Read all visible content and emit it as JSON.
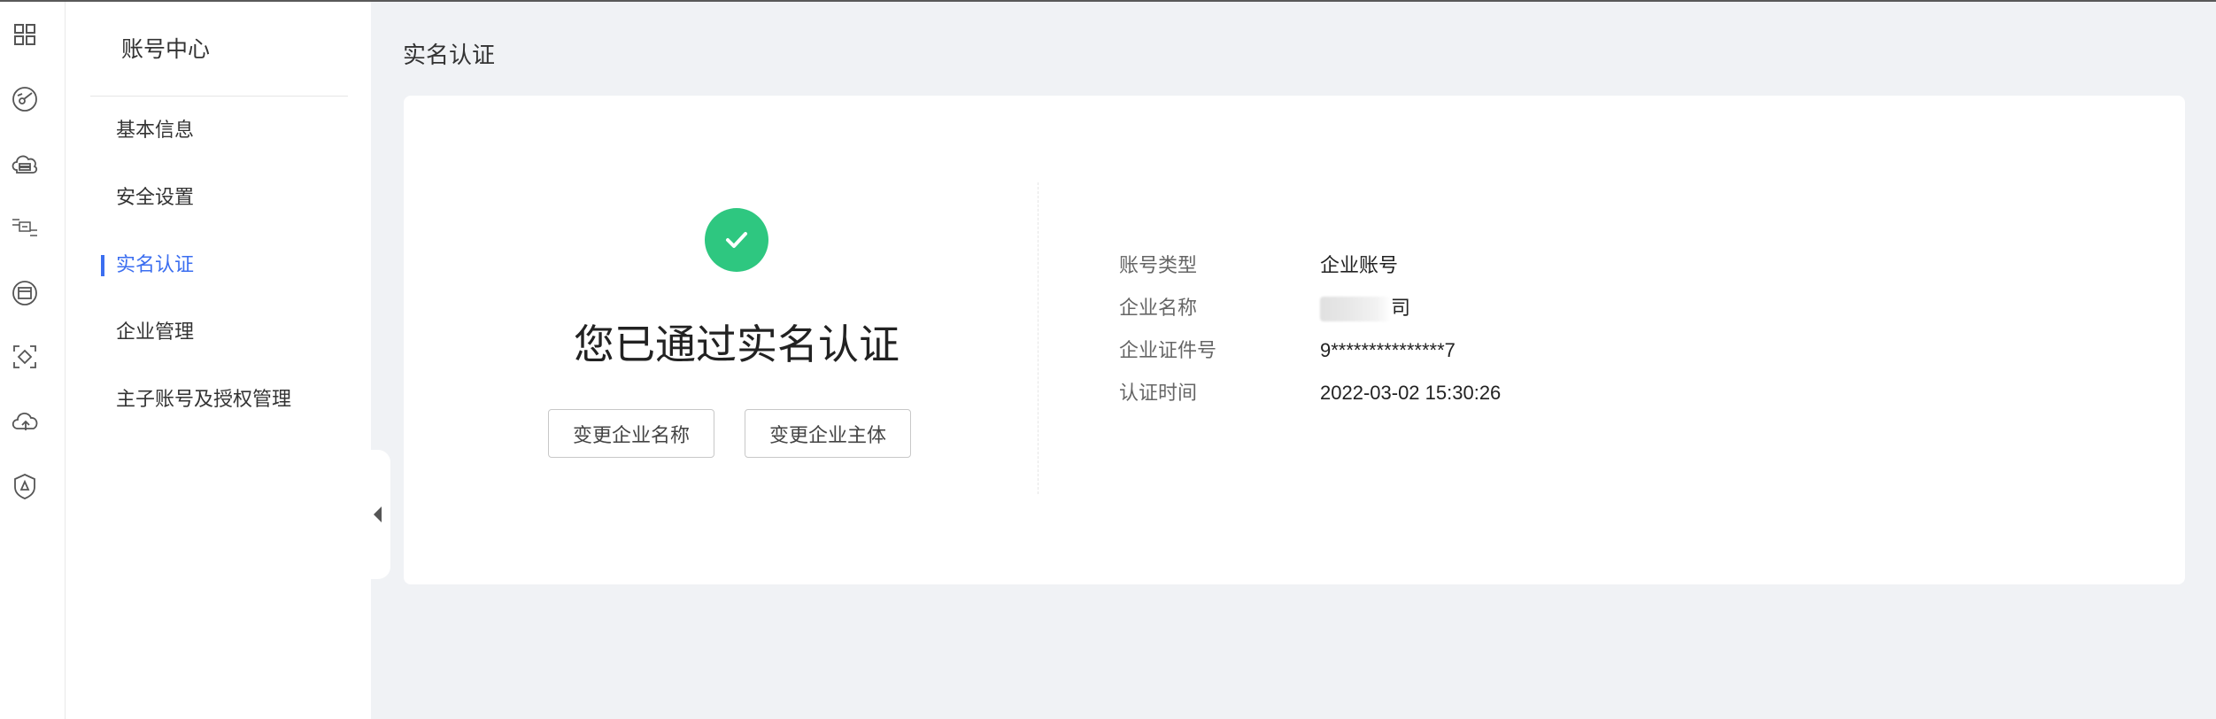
{
  "rail": {
    "icons": [
      "grid-icon",
      "gauge-icon",
      "cloud-server-icon",
      "network-icon",
      "window-icon",
      "scan-icon",
      "cloud-upload-icon",
      "shield-icon"
    ]
  },
  "sidebar": {
    "title": "账号中心",
    "items": [
      {
        "label": "基本信息",
        "active": false
      },
      {
        "label": "安全设置",
        "active": false
      },
      {
        "label": "实名认证",
        "active": true
      },
      {
        "label": "企业管理",
        "active": false
      },
      {
        "label": "主子账号及授权管理",
        "active": false
      }
    ]
  },
  "page": {
    "title": "实名认证"
  },
  "verification": {
    "status_text": "您已通过实名认证",
    "status_color": "#2ec780",
    "buttons": {
      "change_name": "变更企业名称",
      "change_entity": "变更企业主体"
    }
  },
  "details": [
    {
      "label": "账号类型",
      "value": "企业账号"
    },
    {
      "label": "企业名称",
      "value": "司"
    },
    {
      "label": "企业证件号",
      "value": "9***************7"
    },
    {
      "label": "认证时间",
      "value": "2022-03-02 15:30:26"
    }
  ],
  "colors": {
    "accent": "#3b6ef0",
    "success": "#2ec780",
    "background": "#f0f2f5"
  }
}
